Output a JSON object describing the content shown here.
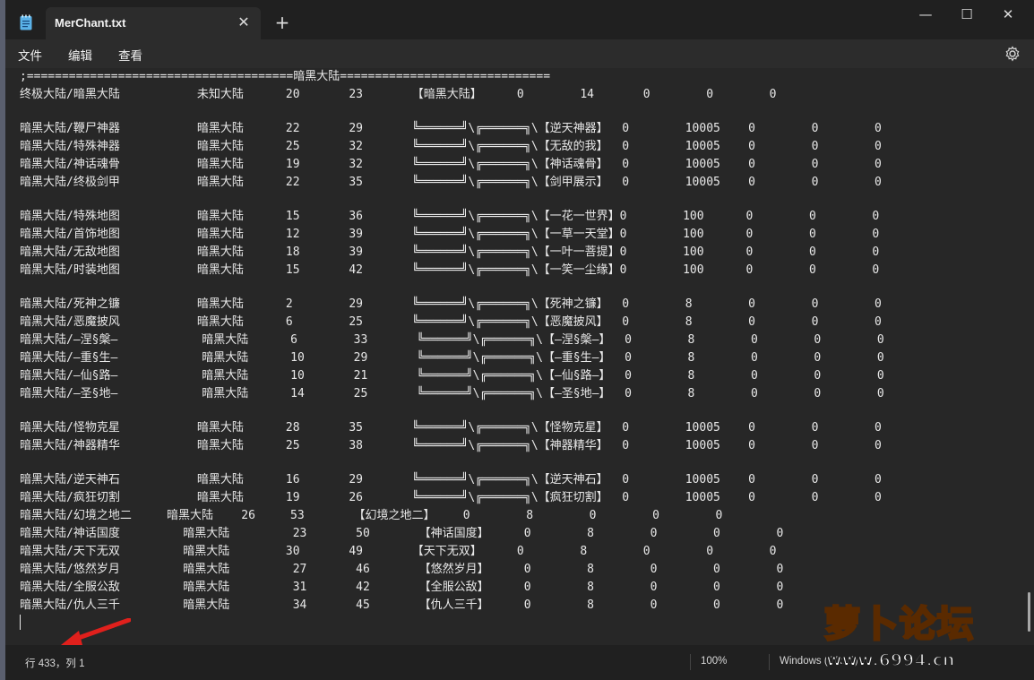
{
  "window": {
    "tab_title": "MerChant.txt",
    "tab_close": "✕",
    "new_tab": "+",
    "minimize": "—",
    "maximize": "☐",
    "close": "✕"
  },
  "menu": {
    "items": [
      "文件",
      "编辑",
      "查看"
    ]
  },
  "editor": {
    "lines": [
      ";======================================暗黑大陆==============================",
      "终极大陆/暗黑大陆           未知大陆      20       23       【暗黑大陆】     0        14       0        0        0",
      "",
      "暗黑大陆/鞭尸神器           暗黑大陆      22       29       ╚══════╝\\╔══════╗\\【逆天神器】  0        10005    0        0        0",
      "暗黑大陆/特殊神器           暗黑大陆      25       32       ╚══════╝\\╔══════╗\\【无敌的我】  0        10005    0        0        0",
      "暗黑大陆/神话魂骨           暗黑大陆      19       32       ╚══════╝\\╔══════╗\\【神话魂骨】  0        10005    0        0        0",
      "暗黑大陆/终极剑甲           暗黑大陆      22       35       ╚══════╝\\╔══════╗\\【剑甲展示】  0        10005    0        0        0",
      "",
      "暗黑大陆/特殊地图           暗黑大陆      15       36       ╚══════╝\\╔══════╗\\【一花一世界】0        100      0        0        0",
      "暗黑大陆/首饰地图           暗黑大陆      12       39       ╚══════╝\\╔══════╗\\【一草一天堂】0        100      0        0        0",
      "暗黑大陆/无敌地图           暗黑大陆      18       39       ╚══════╝\\╔══════╗\\【一叶一菩提】0        100      0        0        0",
      "暗黑大陆/时装地图           暗黑大陆      15       42       ╚══════╝\\╔══════╗\\【一笑一尘缘】0        100      0        0        0",
      "",
      "暗黑大陆/死神之镰           暗黑大陆      2        29       ╚══════╝\\╔══════╗\\【死神之镰】  0        8        0        0        0",
      "暗黑大陆/恶魔披风           暗黑大陆      6        25       ╚══════╝\\╔══════╗\\【恶魔披风】  0        8        0        0        0",
      "暗黑大陆/—涅§槃—            暗黑大陆      6        33       ╚══════╝\\╔══════╗\\【—涅§槃—】  0        8        0        0        0",
      "暗黑大陆/—重§生—            暗黑大陆      10       29       ╚══════╝\\╔══════╗\\【—重§生—】  0        8        0        0        0",
      "暗黑大陆/—仙§路—            暗黑大陆      10       21       ╚══════╝\\╔══════╗\\【—仙§路—】  0        8        0        0        0",
      "暗黑大陆/—圣§地—            暗黑大陆      14       25       ╚══════╝\\╔══════╗\\【—圣§地—】  0        8        0        0        0",
      "",
      "暗黑大陆/怪物克星           暗黑大陆      28       35       ╚══════╝\\╔══════╗\\【怪物克星】  0        10005    0        0        0",
      "暗黑大陆/神器精华           暗黑大陆      25       38       ╚══════╝\\╔══════╗\\【神器精华】  0        10005    0        0        0",
      "",
      "暗黑大陆/逆天神石           暗黑大陆      16       29       ╚══════╝\\╔══════╗\\【逆天神石】  0        10005    0        0        0",
      "暗黑大陆/疯狂切割           暗黑大陆      19       26       ╚══════╝\\╔══════╗\\【疯狂切割】  0        10005    0        0        0",
      "暗黑大陆/幻境之地二     暗黑大陆    26     53       【幻境之地二】    0        8        0        0        0",
      "暗黑大陆/神话国度         暗黑大陆         23       50       【神话国度】     0        8        0        0        0",
      "暗黑大陆/天下无双         暗黑大陆        30       49       【天下无双】     0        8        0        0        0",
      "暗黑大陆/悠然岁月         暗黑大陆         27       46       【悠然岁月】     0        8        0        0        0",
      "暗黑大陆/全服公敌         暗黑大陆         31       42       【全服公敌】     0        8        0        0        0",
      "暗黑大陆/仇人三千         暗黑大陆         34       45       【仇人三千】     0        8        0        0        0"
    ]
  },
  "status": {
    "position": "行 433，列 1",
    "zoom": "100%",
    "eol": "Windows (CRLF)"
  },
  "watermark": {
    "title": "萝卜论坛",
    "url": "www.6994.cn"
  },
  "colors": {
    "background": "#272727",
    "titlebar": "#202020",
    "arrow": "#e0201c"
  }
}
